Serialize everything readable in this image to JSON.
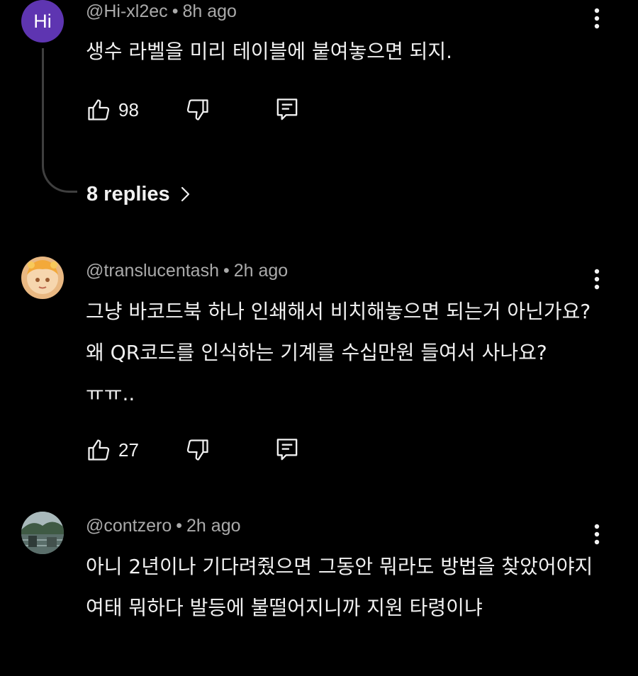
{
  "comments": [
    {
      "avatar_letters": "Hi",
      "avatar_color": "#5e35b1",
      "handle": "@Hi-xl2ec",
      "time": "8h ago",
      "text": "생수 라벨을 미리 테이블에 붙여놓으면 되지.",
      "likes": "98",
      "replies_label": "8 replies"
    },
    {
      "handle": "@translucentash",
      "time": "2h ago",
      "text": "그냥 바코드북 하나 인쇄해서 비치해놓으면 되는거 아닌가요? 왜 QR코드를 인식하는 기계를 수십만원 들여서 사나요?ㅠㅠ..",
      "likes": "27"
    },
    {
      "handle": "@contzero",
      "time": "2h ago",
      "text": "아니 2년이나 기다려줬으면 그동안 뭐라도 방법을 찾았어야지 여태 뭐하다 발등에 불떨어지니까 지원 타령이냐"
    }
  ],
  "separator": "•",
  "icons": {
    "more": "more-vert-icon",
    "like": "thumb-up-icon",
    "dislike": "thumb-down-icon",
    "reply": "reply-icon",
    "chevron": "chevron-right-icon"
  }
}
